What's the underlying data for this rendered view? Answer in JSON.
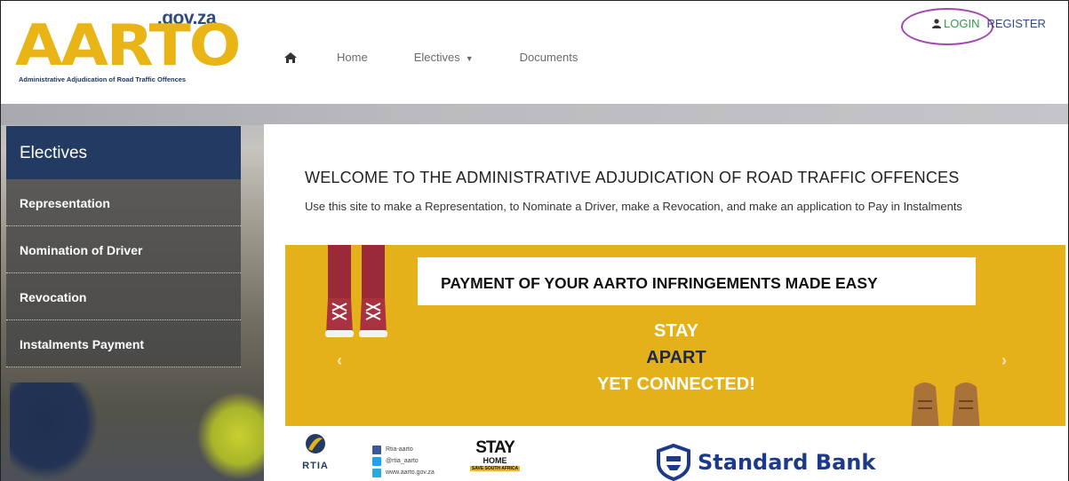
{
  "header": {
    "logo_gov": ".gov.za",
    "logo_text": "AARTO",
    "logo_tagline": "Administrative Adjudication of Road Traffic Offences",
    "nav": [
      {
        "label": "Home"
      },
      {
        "label": "Electives"
      },
      {
        "label": "Documents"
      }
    ],
    "login_label": "LOGIN",
    "register_label": "REGISTER"
  },
  "sidebar": {
    "title": "Electives",
    "items": [
      {
        "label": "Representation"
      },
      {
        "label": "Nomination of Driver"
      },
      {
        "label": "Revocation"
      },
      {
        "label": "Instalments Payment"
      }
    ]
  },
  "main": {
    "welcome": "WELCOME TO THE ADMINISTRATIVE ADJUDICATION OF ROAD TRAFFIC OFFENCES",
    "subtext": "Use this site to make a Representation, to Nominate a Driver, make a Revocation, and make an application to Pay in Instalments"
  },
  "banner": {
    "headline": "PAYMENT OF YOUR AARTO INFRINGEMENTS MADE EASY",
    "line1": "STAY",
    "line2": "APART",
    "line3": "YET CONNECTED!",
    "prev_arrow": "‹",
    "next_arrow": "›",
    "accent_color": "#e5b11a"
  },
  "footer": {
    "rtia": "RTIA",
    "social": [
      {
        "icon": "facebook-icon",
        "text": "Rtia-aarto",
        "color": "#3b5998"
      },
      {
        "icon": "twitter-icon",
        "text": "@rtia_aarto",
        "color": "#1da1f2"
      },
      {
        "icon": "globe-icon",
        "text": "www.aarto.gov.za",
        "color": "#2aa8e0"
      }
    ],
    "stay_home_big": "STAY",
    "stay_home_small": "HOME",
    "stay_home_tag": "SAVE SOUTH AFRICA",
    "bank": "Standard Bank"
  },
  "colors": {
    "navy": "#233a62",
    "login_green": "#2e9a4a",
    "highlight_circle": "#a347b0"
  }
}
